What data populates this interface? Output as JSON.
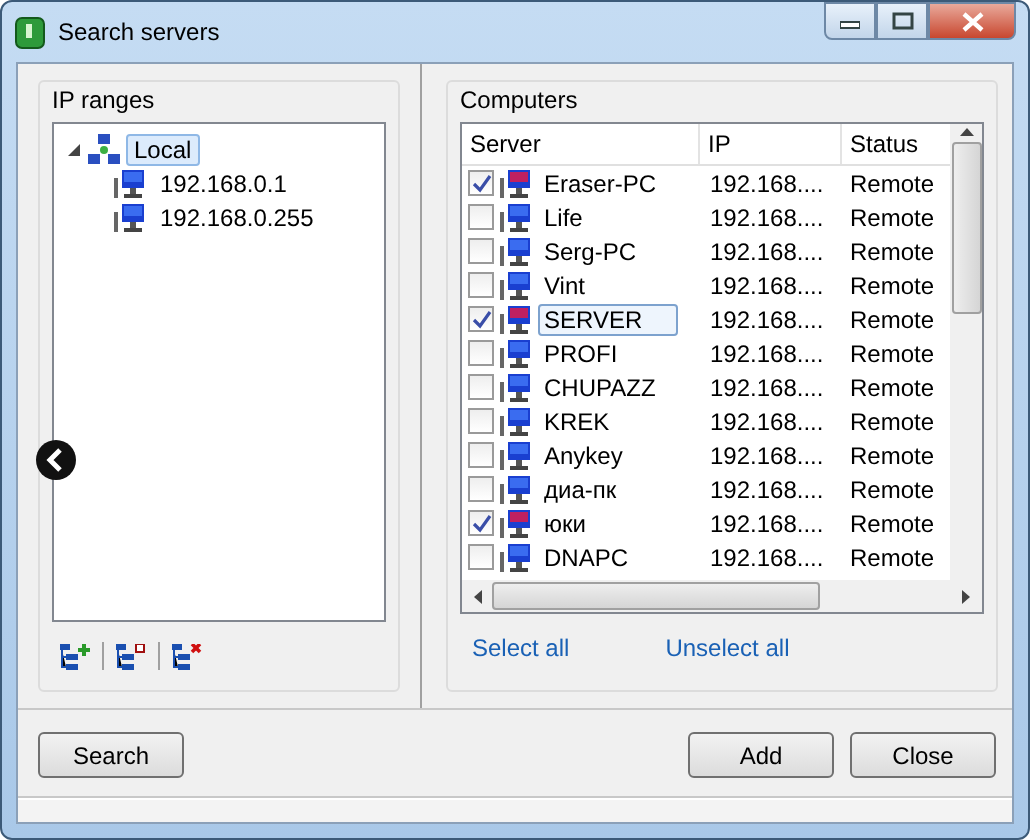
{
  "window": {
    "title": "Search servers"
  },
  "ip_ranges": {
    "title": "IP ranges",
    "tree": [
      {
        "label": "Local",
        "expanded": true,
        "selected": true,
        "children": [
          {
            "label": "192.168.0.1",
            "selected": false
          },
          {
            "label": "192.168.0.255",
            "selected": false
          }
        ]
      }
    ]
  },
  "computers": {
    "title": "Computers",
    "columns": [
      "Server",
      "IP",
      "Status"
    ],
    "rows": [
      {
        "server": "Eraser-PC",
        "ip": "192.168....",
        "status": "Remote",
        "checked": true,
        "selected": false
      },
      {
        "server": "Life",
        "ip": "192.168....",
        "status": "Remote",
        "checked": false,
        "selected": false
      },
      {
        "server": "Serg-PC",
        "ip": "192.168....",
        "status": "Remote",
        "checked": false,
        "selected": false
      },
      {
        "server": "Vint",
        "ip": "192.168....",
        "status": "Remote",
        "checked": false,
        "selected": false
      },
      {
        "server": "SERVER",
        "ip": "192.168....",
        "status": "Remote",
        "checked": true,
        "selected": true
      },
      {
        "server": "PROFI",
        "ip": "192.168....",
        "status": "Remote",
        "checked": false,
        "selected": false
      },
      {
        "server": "CHUPAZZ",
        "ip": "192.168....",
        "status": "Remote",
        "checked": false,
        "selected": false
      },
      {
        "server": "KREK",
        "ip": "192.168....",
        "status": "Remote",
        "checked": false,
        "selected": false
      },
      {
        "server": "Anykey",
        "ip": "192.168....",
        "status": "Remote",
        "checked": false,
        "selected": false
      },
      {
        "server": "диа-пк",
        "ip": "192.168....",
        "status": "Remote",
        "checked": false,
        "selected": false
      },
      {
        "server": "юки",
        "ip": "192.168....",
        "status": "Remote",
        "checked": true,
        "selected": false
      },
      {
        "server": "DNAPC",
        "ip": "192.168....",
        "status": "Remote",
        "checked": false,
        "selected": false
      }
    ],
    "links": [
      "Select all",
      "Unselect all"
    ]
  },
  "buttons": [
    {
      "label": "Search",
      "kind": "left"
    },
    {
      "label": "Add",
      "kind": "right"
    },
    {
      "label": "Close",
      "kind": "right"
    }
  ]
}
